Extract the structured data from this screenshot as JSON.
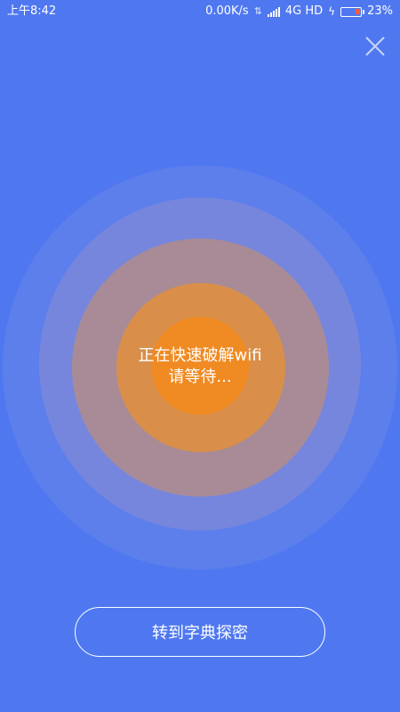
{
  "status_bar": {
    "time": "上午8:42",
    "network_speed": "0.00K/s",
    "network_type": "4G HD",
    "battery_percent": "23%"
  },
  "icons": {
    "close": "close-icon",
    "data_transfer": "data-transfer-icon",
    "signal": "signal-icon",
    "charging": "charging-icon",
    "battery": "battery-icon"
  },
  "colors": {
    "background": "#4f78f0",
    "accent": "#f08a22",
    "text": "#ffffff"
  },
  "main": {
    "status_line1": "正在快速破解wifi",
    "status_line2": "请等待..."
  },
  "actions": {
    "dictionary_button_label": "转到字典探密"
  }
}
